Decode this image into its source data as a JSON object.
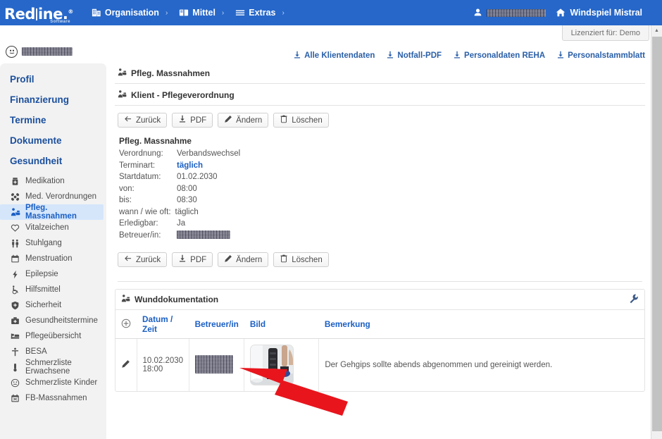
{
  "app": {
    "logo_main_left": "Red",
    "logo_main_right": "ine",
    "logo_dot": ".",
    "logo_sub": "Software",
    "license_text": "Lizenziert für: Demo"
  },
  "nav": {
    "items": [
      {
        "label": "Organisation",
        "icon": "building-icon",
        "chevron": "›"
      },
      {
        "label": "Mittel",
        "icon": "book-icon",
        "chevron": "›"
      },
      {
        "label": "Extras",
        "icon": "hamburger-icon",
        "chevron": "›"
      }
    ],
    "user": {
      "label": "",
      "icon": "user-icon",
      "redacted": true
    },
    "home": {
      "label": "Windspiel Mistral",
      "icon": "home-icon"
    }
  },
  "sidebar": {
    "client": {
      "label": "",
      "icon": "client-avatar-icon",
      "redacted": true
    },
    "top_items": [
      {
        "label": "Profil"
      },
      {
        "label": "Finanzierung"
      },
      {
        "label": "Termine"
      },
      {
        "label": "Dokumente"
      },
      {
        "label": "Gesundheit"
      }
    ],
    "sub_items": [
      {
        "label": "Medikation",
        "icon": "pill-bottle-icon",
        "active": false
      },
      {
        "label": "Med. Verordnungen",
        "icon": "bandage-icon",
        "active": false
      },
      {
        "label": "Pfleg. Massnahmen",
        "icon": "nursing-care-icon",
        "active": true
      },
      {
        "label": "Vitalzeichen",
        "icon": "heart-icon",
        "active": false
      },
      {
        "label": "Stuhlgang",
        "icon": "people-icon",
        "active": false
      },
      {
        "label": "Menstruation",
        "icon": "calendar-icon",
        "active": false
      },
      {
        "label": "Epilepsie",
        "icon": "bolt-icon",
        "active": false
      },
      {
        "label": "Hilfsmittel",
        "icon": "wheelchair-icon",
        "active": false
      },
      {
        "label": "Sicherheit",
        "icon": "shield-icon",
        "active": false
      },
      {
        "label": "Gesundheitstermine",
        "icon": "medical-bag-icon",
        "active": false
      },
      {
        "label": "Pflegeübersicht",
        "icon": "bed-icon",
        "active": false
      },
      {
        "label": "BESA",
        "icon": "person-icon",
        "active": false
      },
      {
        "label": "Schmerzliste Erwachsene",
        "icon": "thermometer-icon",
        "active": false
      },
      {
        "label": "Schmerzliste Kinder",
        "icon": "face-icon",
        "active": false
      },
      {
        "label": "FB-Massnahmen",
        "icon": "checklist-icon",
        "active": false
      }
    ]
  },
  "toolbar": {
    "downloads": [
      {
        "label": "Alle Klientendaten",
        "icon": "download-icon"
      },
      {
        "label": "Notfall-PDF",
        "icon": "download-icon"
      },
      {
        "label": "Personaldaten REHA",
        "icon": "download-icon"
      },
      {
        "label": "Personalstammblatt",
        "icon": "download-icon"
      }
    ]
  },
  "main": {
    "page_title": "Pfleg. Massnahmen",
    "page_title_icon": "nursing-care-icon",
    "section_title": "Klient - Pflegeverordnung",
    "section_title_icon": "nursing-care-icon",
    "buttons": [
      {
        "label": "Zurück",
        "icon": "arrow-left-icon"
      },
      {
        "label": "PDF",
        "icon": "download-icon"
      },
      {
        "label": "Ändern",
        "icon": "pencil-icon"
      },
      {
        "label": "Löschen",
        "icon": "trash-icon"
      }
    ],
    "detail": {
      "title": "Pfleg. Massnahme",
      "rows": [
        {
          "label": "Verordnung:",
          "value": "Verbandswechsel",
          "accent": false,
          "redacted": false
        },
        {
          "label": "Terminart:",
          "value": "täglich",
          "accent": true,
          "redacted": false
        },
        {
          "label": "Startdatum:",
          "value": "01.02.2030",
          "accent": false,
          "redacted": false
        },
        {
          "label": "von:",
          "value": "08:00",
          "accent": false,
          "redacted": false
        },
        {
          "label": "bis:",
          "value": "08:30",
          "accent": false,
          "redacted": false
        },
        {
          "label": "wann / wie oft:",
          "value": "täglich",
          "accent": false,
          "redacted": false,
          "wide": true
        },
        {
          "label": "Erledigbar:",
          "value": "Ja",
          "accent": false,
          "redacted": false
        },
        {
          "label": "Betreuer/in:",
          "value": "",
          "accent": false,
          "redacted": true
        }
      ]
    },
    "wunddokumentation": {
      "title": "Wunddokumentation",
      "title_icon": "nursing-care-icon",
      "tool_icon": "wrench-icon",
      "add_icon": "plus-circle-icon",
      "columns": [
        "",
        "Datum / Zeit",
        "Betreuer/in",
        "Bild",
        "Bemerkung"
      ],
      "rows": [
        {
          "action_icon": "pencil-icon",
          "date": "10.02.2030",
          "time": "18:00",
          "betreuer": "",
          "betreuer_redacted": true,
          "image_alt": "walking-cast-photo",
          "bemerkung": "Der Gehgips sollte abends abgenommen und gereinigt werden."
        }
      ]
    }
  },
  "annotation": {
    "arrow": {
      "color": "#e8151d",
      "points_to": "wound-photo-thumbnail"
    }
  },
  "colors": {
    "brand_blue": "#2667c9",
    "link_blue": "#1b5fc4",
    "sidebar_bg": "#f2f2f2",
    "active_bg": "#d5e6fb",
    "annotation_red": "#e8151d"
  }
}
